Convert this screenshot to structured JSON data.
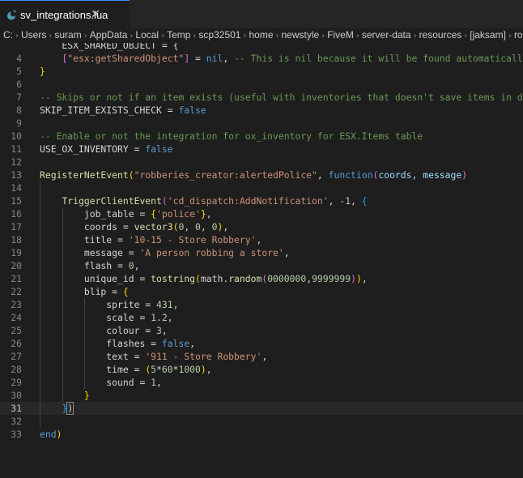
{
  "tab": {
    "icon": "moon-icon",
    "filename": "sv_integrations.lua",
    "close_glyph": "✕"
  },
  "breadcrumb": {
    "separator": "›",
    "items": [
      "C:",
      "Users",
      "suram",
      "AppData",
      "Local",
      "Temp",
      "scp32501",
      "home",
      "newstyle",
      "FiveM",
      "server-data",
      "resources",
      "[jaksam]",
      "robbe"
    ]
  },
  "editor": {
    "current_line": 31,
    "lines": [
      {
        "n": "",
        "tokens": [
          [
            "p",
            "    ESX_SHARED_OBJECT = {"
          ]
        ]
      },
      {
        "n": "4",
        "tokens": [
          [
            "p",
            "    "
          ],
          [
            "b2",
            "["
          ],
          [
            "s",
            "\"esx:getSharedObject\""
          ],
          [
            "b2",
            "]"
          ],
          [
            "p",
            " = "
          ],
          [
            "k",
            "nil"
          ],
          [
            "p",
            ", "
          ],
          [
            "c",
            "-- This is nil because it will be found automatically, cha"
          ]
        ]
      },
      {
        "n": "5",
        "tokens": [
          [
            "b1",
            "}"
          ]
        ]
      },
      {
        "n": "6",
        "tokens": []
      },
      {
        "n": "7",
        "tokens": [
          [
            "c",
            "-- Skips or not if an item exists (useful with inventories that doesn't save items in databas"
          ]
        ]
      },
      {
        "n": "8",
        "tokens": [
          [
            "p",
            "SKIP_ITEM_EXISTS_CHECK = "
          ],
          [
            "k",
            "false"
          ]
        ]
      },
      {
        "n": "9",
        "tokens": []
      },
      {
        "n": "10",
        "tokens": [
          [
            "c",
            "-- Enable or not the integration for ox_inventory for ESX.Items table"
          ]
        ]
      },
      {
        "n": "11",
        "tokens": [
          [
            "p",
            "USE_OX_INVENTORY = "
          ],
          [
            "k",
            "false"
          ]
        ]
      },
      {
        "n": "12",
        "tokens": []
      },
      {
        "n": "13",
        "tokens": [
          [
            "f",
            "RegisterNetEvent"
          ],
          [
            "b1",
            "("
          ],
          [
            "s",
            "\"robberies_creator:alertedPolice\""
          ],
          [
            "p",
            ", "
          ],
          [
            "k",
            "function"
          ],
          [
            "b2",
            "("
          ],
          [
            "v",
            "coords"
          ],
          [
            "p",
            ", "
          ],
          [
            "v",
            "message"
          ],
          [
            "b2",
            ")"
          ]
        ]
      },
      {
        "n": "14",
        "tokens": []
      },
      {
        "n": "15",
        "tokens": [
          [
            "p",
            "    "
          ],
          [
            "f",
            "TriggerClientEvent"
          ],
          [
            "b2",
            "("
          ],
          [
            "s",
            "'cd_dispatch:AddNotification'"
          ],
          [
            "p",
            ", "
          ],
          [
            "n",
            "-1"
          ],
          [
            "p",
            ", "
          ],
          [
            "b3",
            "{"
          ]
        ]
      },
      {
        "n": "16",
        "tokens": [
          [
            "p",
            "        job_table = "
          ],
          [
            "b1",
            "{"
          ],
          [
            "s",
            "'police'"
          ],
          [
            "b1",
            "}"
          ],
          [
            "p",
            ","
          ]
        ]
      },
      {
        "n": "17",
        "tokens": [
          [
            "p",
            "        coords = "
          ],
          [
            "f",
            "vector3"
          ],
          [
            "b1",
            "("
          ],
          [
            "n",
            "0"
          ],
          [
            "p",
            ", "
          ],
          [
            "n",
            "0"
          ],
          [
            "p",
            ", "
          ],
          [
            "n",
            "0"
          ],
          [
            "b1",
            ")"
          ],
          [
            "p",
            ","
          ]
        ]
      },
      {
        "n": "18",
        "tokens": [
          [
            "p",
            "        title = "
          ],
          [
            "s",
            "'10-15 - Store Robbery'"
          ],
          [
            "p",
            ","
          ]
        ]
      },
      {
        "n": "19",
        "tokens": [
          [
            "p",
            "        message = "
          ],
          [
            "s",
            "'A person robbing a store'"
          ],
          [
            "p",
            ","
          ]
        ]
      },
      {
        "n": "20",
        "tokens": [
          [
            "p",
            "        flash = "
          ],
          [
            "n",
            "0"
          ],
          [
            "p",
            ","
          ]
        ]
      },
      {
        "n": "21",
        "tokens": [
          [
            "p",
            "        unique_id = "
          ],
          [
            "f",
            "tostring"
          ],
          [
            "b1",
            "("
          ],
          [
            "p",
            "math."
          ],
          [
            "f",
            "random"
          ],
          [
            "b2",
            "("
          ],
          [
            "n",
            "0000000"
          ],
          [
            "p",
            ","
          ],
          [
            "n",
            "9999999"
          ],
          [
            "b2",
            ")"
          ],
          [
            "b1",
            ")"
          ],
          [
            "p",
            ","
          ]
        ]
      },
      {
        "n": "22",
        "tokens": [
          [
            "p",
            "        blip = "
          ],
          [
            "b1",
            "{"
          ]
        ]
      },
      {
        "n": "23",
        "tokens": [
          [
            "p",
            "            sprite = "
          ],
          [
            "n",
            "431"
          ],
          [
            "p",
            ","
          ]
        ]
      },
      {
        "n": "24",
        "tokens": [
          [
            "p",
            "            scale = "
          ],
          [
            "n",
            "1.2"
          ],
          [
            "p",
            ","
          ]
        ]
      },
      {
        "n": "25",
        "tokens": [
          [
            "p",
            "            colour = "
          ],
          [
            "n",
            "3"
          ],
          [
            "p",
            ","
          ]
        ]
      },
      {
        "n": "26",
        "tokens": [
          [
            "p",
            "            flashes = "
          ],
          [
            "k",
            "false"
          ],
          [
            "p",
            ","
          ]
        ]
      },
      {
        "n": "27",
        "tokens": [
          [
            "p",
            "            text = "
          ],
          [
            "s",
            "'911 - Store Robbery'"
          ],
          [
            "p",
            ","
          ]
        ]
      },
      {
        "n": "28",
        "tokens": [
          [
            "p",
            "            time = "
          ],
          [
            "b1",
            "("
          ],
          [
            "n",
            "5"
          ],
          [
            "p",
            "*"
          ],
          [
            "n",
            "60"
          ],
          [
            "p",
            "*"
          ],
          [
            "n",
            "1000"
          ],
          [
            "b1",
            ")"
          ],
          [
            "p",
            ","
          ]
        ]
      },
      {
        "n": "29",
        "tokens": [
          [
            "p",
            "            sound = "
          ],
          [
            "n",
            "1"
          ],
          [
            "p",
            ","
          ]
        ]
      },
      {
        "n": "30",
        "tokens": [
          [
            "p",
            "        "
          ],
          [
            "b1",
            "}"
          ]
        ]
      },
      {
        "n": "31",
        "tokens": [
          [
            "p",
            "    "
          ],
          [
            "b3",
            "}"
          ],
          [
            "bm",
            ")"
          ]
        ]
      },
      {
        "n": "32",
        "tokens": []
      },
      {
        "n": "33",
        "tokens": [
          [
            "k",
            "end"
          ],
          [
            "b1",
            ")"
          ]
        ]
      }
    ]
  }
}
